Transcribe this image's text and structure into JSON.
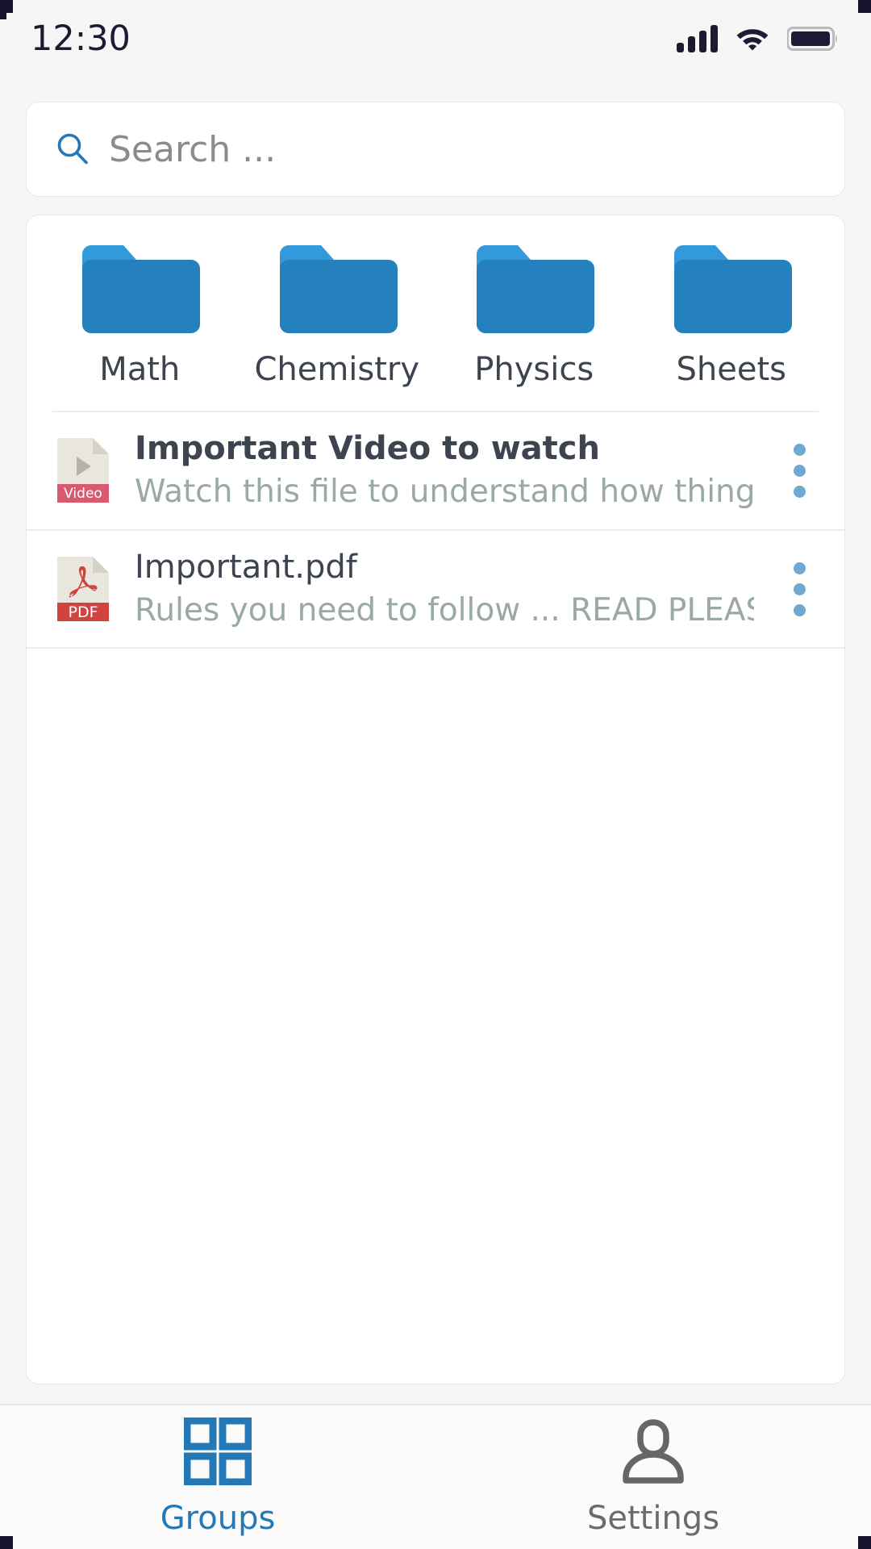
{
  "status_bar": {
    "time": "12:30",
    "signal_icon": "signal-bars-icon",
    "signal_bars": 4,
    "wifi_icon": "wifi-icon",
    "battery_icon": "battery-full-icon",
    "text_color": "#1c1b33"
  },
  "search": {
    "icon": "search-icon",
    "placeholder": "Search ...",
    "value": "",
    "icon_color": "#2378b5"
  },
  "folders": [
    {
      "label": "Math",
      "icon": "folder-icon",
      "color": "#2581bd"
    },
    {
      "label": "Chemistry",
      "icon": "folder-icon",
      "color": "#2581bd"
    },
    {
      "label": "Physics",
      "icon": "folder-icon",
      "color": "#2581bd"
    },
    {
      "label": "Sheets",
      "icon": "folder-icon",
      "color": "#2581bd"
    }
  ],
  "files": [
    {
      "title": "Important Video to watch",
      "subtitle": "Watch this file to understand how things ...",
      "icon": "video-file-icon",
      "badge": "Video",
      "badge_color": "#d85a71",
      "menu_icon": "more-vertical-icon"
    },
    {
      "title": "Important.pdf",
      "subtitle": "Rules you need to follow ... READ PLEASE",
      "icon": "pdf-file-icon",
      "badge": "PDF",
      "badge_color": "#d0433e",
      "menu_icon": "more-vertical-icon"
    }
  ],
  "bottom_nav": {
    "items": [
      {
        "label": "Groups",
        "icon": "grid-squares-icon",
        "active": true,
        "color": "#2378b5"
      },
      {
        "label": "Settings",
        "icon": "person-icon",
        "active": false,
        "color": "#6b6b6b"
      }
    ]
  },
  "theme": {
    "page_background": "#f5f6f6",
    "card_background": "#ffffff",
    "card_border": "#e7e8e8",
    "accent": "#2378b5",
    "title_text": "#3d4450",
    "subtitle_text": "#9aa8a8"
  }
}
